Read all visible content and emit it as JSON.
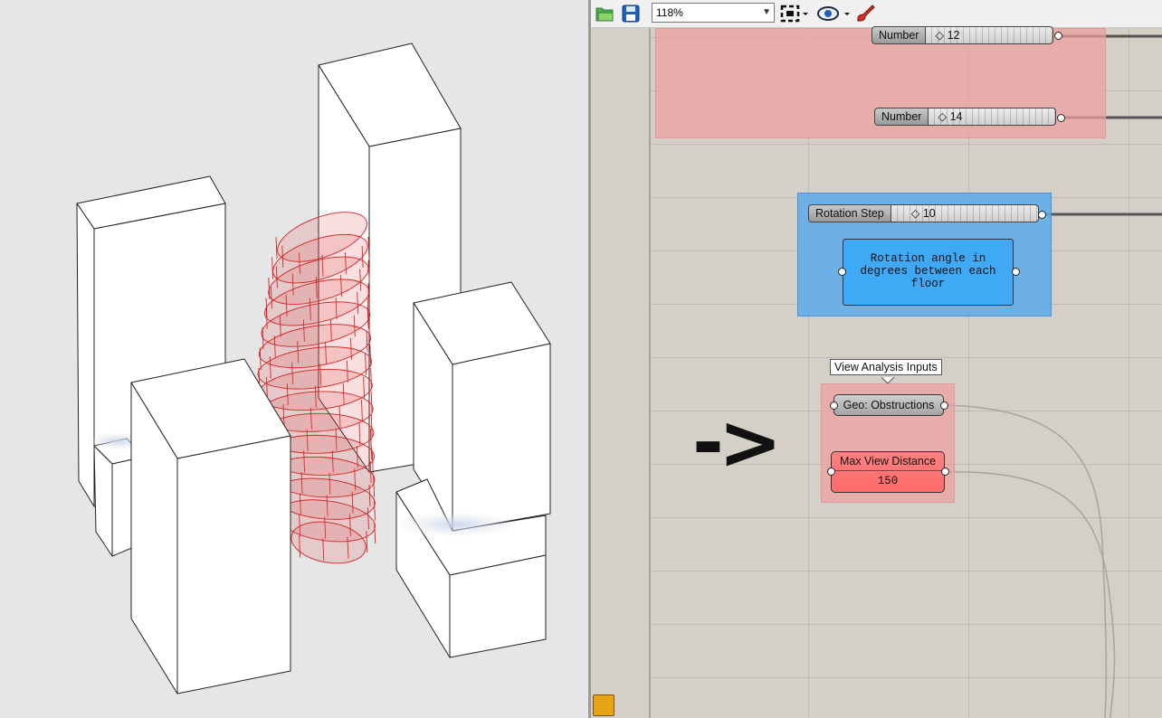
{
  "toolbar": {
    "zoom_value": "118%",
    "icons": [
      "open-folder-icon",
      "save-disk-icon",
      "zoom-extents-icon",
      "preview-eye-icon",
      "sketch-brush-icon"
    ]
  },
  "canvas": {
    "sliders": [
      {
        "label": "Number",
        "value": "12"
      },
      {
        "label": "Number",
        "value": "14"
      },
      {
        "label": "Rotation Step",
        "value": "10"
      }
    ],
    "panel_text": "Rotation angle in degrees between each floor",
    "tooltip": "View Analysis Inputs",
    "geo_component": "Geo: Obstructions",
    "max_view": {
      "label": "Max View Distance",
      "value": "150"
    },
    "arrow_annotation": "->"
  },
  "colors": {
    "canvas_bg": "#d4d0c8",
    "group_red": "#efaaaa",
    "group_blue": "#5aaaeb",
    "panel_blue": "#3fa9f5",
    "tower_red": "#d81f1f"
  }
}
